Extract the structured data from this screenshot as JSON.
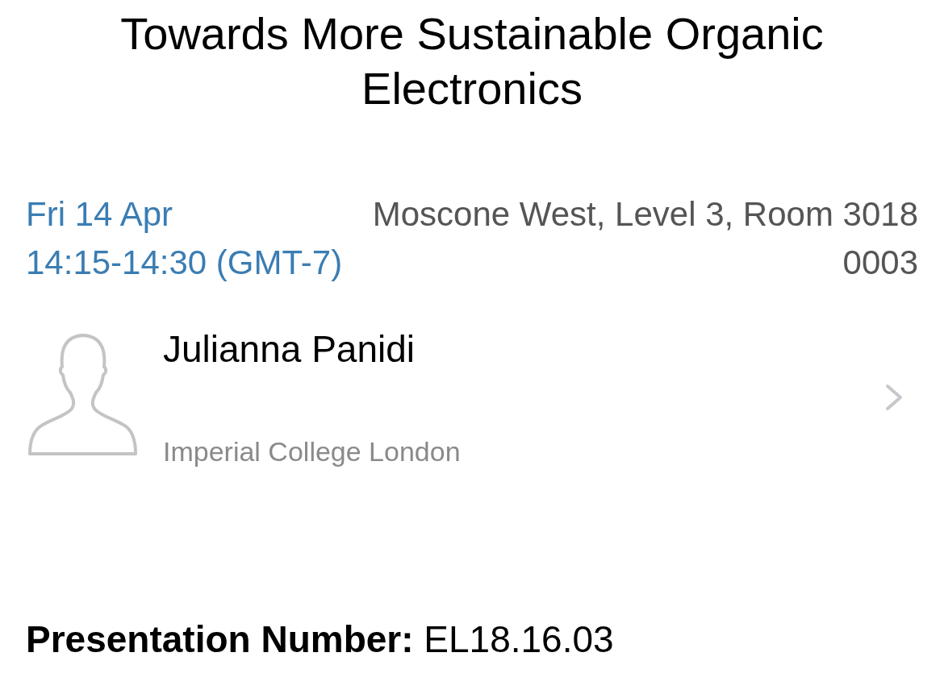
{
  "title": "Towards More Sustainable Organic Electronics",
  "session": {
    "date": "Fri 14 Apr",
    "time": "14:15-14:30 (GMT-7)",
    "location": "Moscone West, Level 3, Room 3018",
    "code": "0003"
  },
  "speaker": {
    "name": "Julianna Panidi",
    "affiliation": "Imperial College London"
  },
  "presentation_number": "**Presentation Number:** EL18.16.03"
}
